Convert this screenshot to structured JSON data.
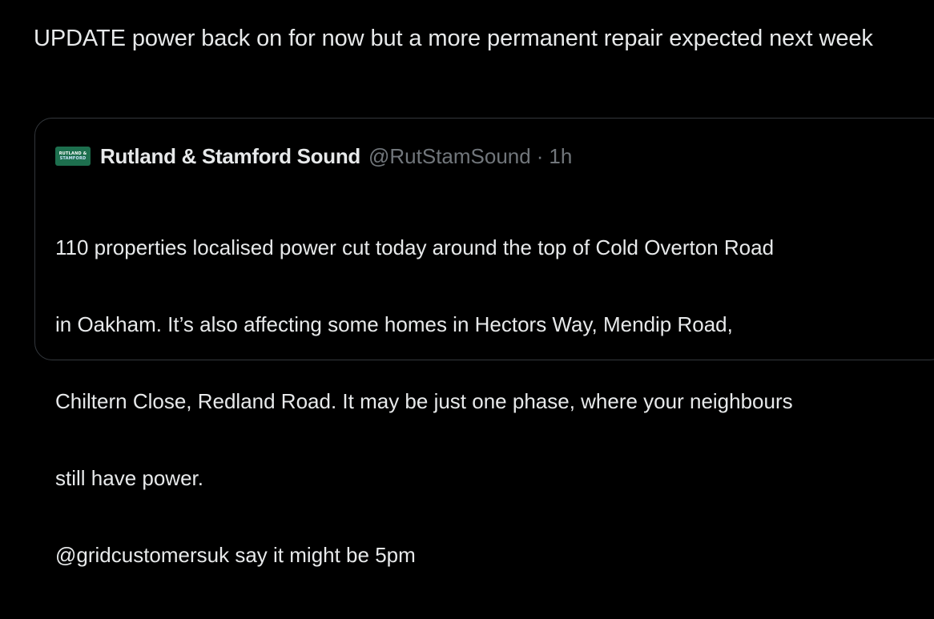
{
  "tweet": {
    "text": "UPDATE power back on for now but a more permanent repair expected next week"
  },
  "quoted_tweet": {
    "avatar": {
      "logo_line1": "RUTLAND &",
      "logo_line2": "STAMFORD",
      "bg_color": "#1d6f4e"
    },
    "display_name": "Rutland & Stamford Sound",
    "handle": "@RutStamSound",
    "separator": "·",
    "time": "1h",
    "body_lines": [
      "110 properties localised power cut today around the top of Cold Overton Road",
      "in Oakham. It’s also affecting some homes in Hectors Way, Mendip Road,",
      "Chiltern Close, Redland Road. It may be just one phase, where your neighbours",
      "still have power.",
      "@gridcustomersuk say it might be 5pm"
    ]
  },
  "colors": {
    "background": "#000000",
    "primary_text": "#e7e9ea",
    "secondary_text": "#71767b",
    "border": "#33373c"
  }
}
